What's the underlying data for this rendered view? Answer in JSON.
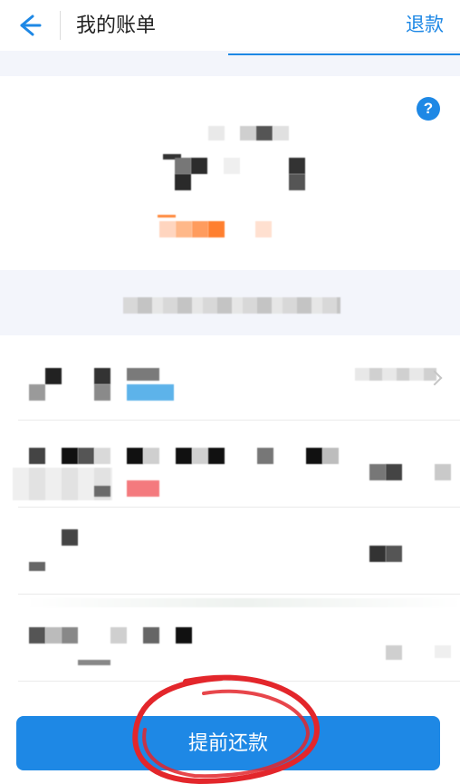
{
  "header": {
    "title": "我的账单",
    "refund_label": "退款"
  },
  "summary": {
    "help_symbol": "?"
  },
  "footer": {
    "cta_label": "提前还款"
  },
  "colors": {
    "accent": "#1e88e5",
    "annotation": "#e3262b"
  },
  "icons": {
    "back": "arrow-left-icon",
    "help": "question-icon"
  }
}
